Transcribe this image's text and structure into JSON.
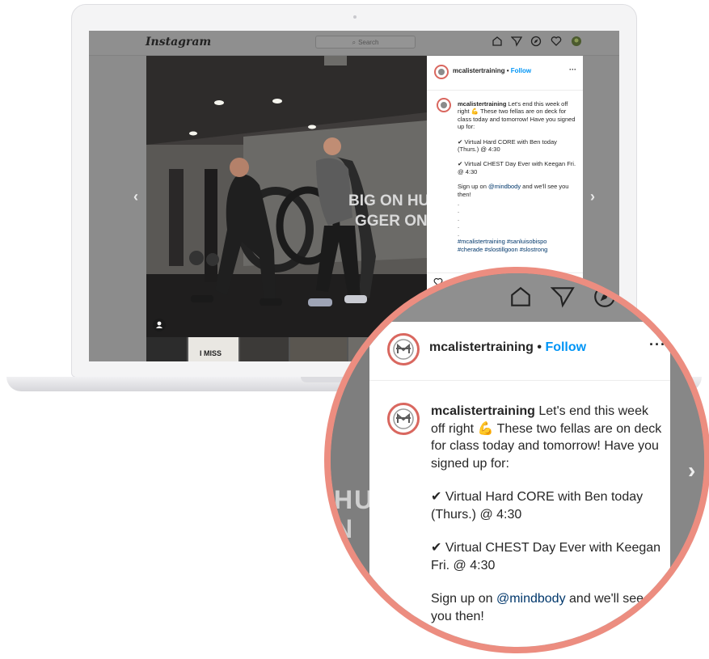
{
  "instagram": {
    "logo": "Instagram",
    "search_placeholder": "Search",
    "nav_icons": [
      "home-icon",
      "direct-message-icon",
      "explore-icon",
      "activity-heart-icon",
      "profile-avatar"
    ]
  },
  "post": {
    "username": "mcalistertraining",
    "separator": " • ",
    "follow_label": "Follow",
    "more_label": "···",
    "caption_intro": " Let's end this week off right 💪 These two fellas are on deck for class today and tomorrow! Have you signed up for:",
    "caption_item_1": "✔ Virtual Hard CORE with Ben today (Thurs.) @ 4:30",
    "caption_item_2": "✔ Virtual CHEST Day Ever with Keegan Fri. @ 4:30",
    "caption_signup_pre": "Sign up on ",
    "caption_mention": "@mindbody",
    "caption_signup_post": " and we'll see you then!",
    "dots": ".",
    "hashtags_line1": "#mcalistertraining #sanluisobispo",
    "hashtags_line2": "#cherade #slostillgoon #slostrong"
  },
  "photo": {
    "wall_text_line1": "BIG ON HU",
    "wall_text_line2": "GGER ON",
    "thumb_text": "I MISS",
    "prev_arrow": "‹",
    "next_arrow": "›"
  },
  "magnifier": {
    "wall_text_line1": "HU",
    "wall_text_line2": "N",
    "next_arrow": "›"
  },
  "colors": {
    "follow_blue": "#0095f6",
    "mention_blue": "#00376b",
    "magnifier_ring": "#ec8d80"
  }
}
